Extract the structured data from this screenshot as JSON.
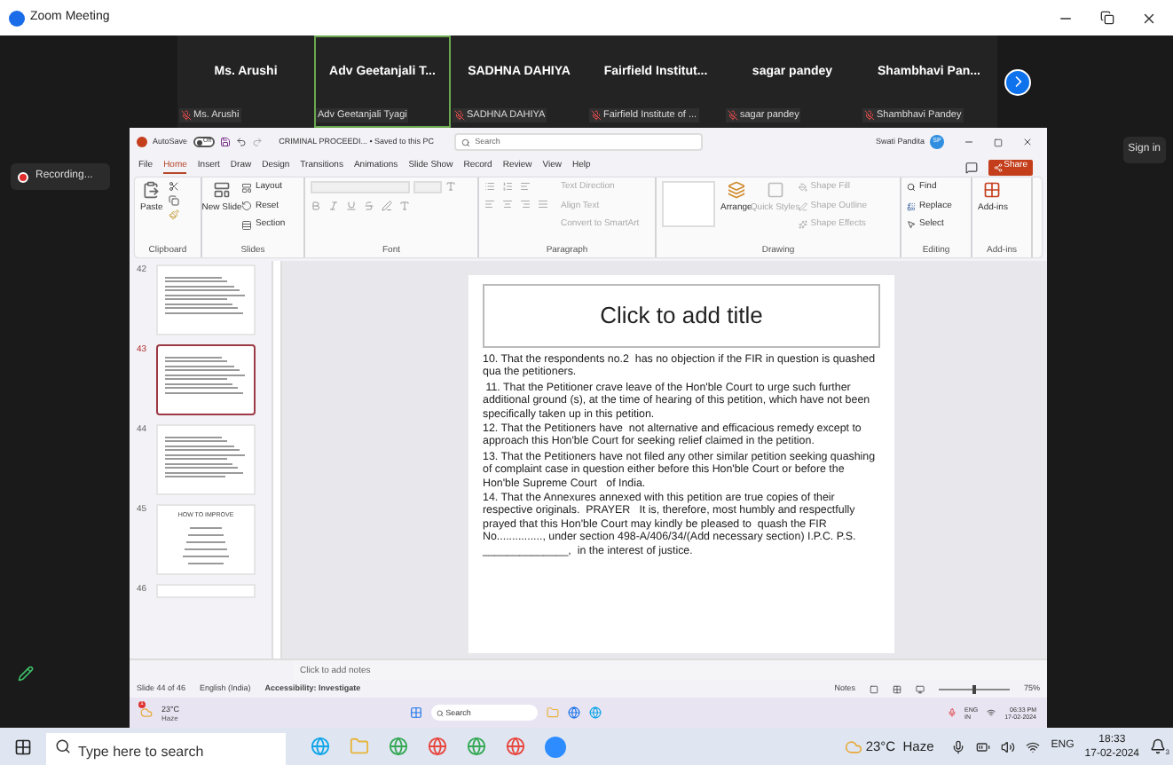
{
  "window": {
    "title": "Zoom Meeting"
  },
  "participants": [
    {
      "name": "Ms. Arushi",
      "label": "Ms. Arushi",
      "speaking": false
    },
    {
      "name": "Adv Geetanjali T...",
      "label": "Adv Geetanjali Tyagi",
      "speaking": true
    },
    {
      "name": "SADHNA DAHIYA",
      "label": "SADHNA DAHIYA",
      "speaking": false
    },
    {
      "name": "Fairfield Institut...",
      "label": "Fairfield Institute of ...",
      "speaking": false
    },
    {
      "name": "sagar pandey",
      "label": "sagar pandey",
      "speaking": false
    },
    {
      "name": "Shambhavi Pan...",
      "label": "Shambhavi Pandey",
      "speaking": false
    }
  ],
  "recording": "Recording...",
  "sign_in": "Sign in",
  "ppt": {
    "autosave": "AutoSave",
    "autosave_state": "Off",
    "autosave_on": false,
    "file_title": "CRIMINAL PROCEEDI... • Saved to this PC",
    "search": {
      "placeholder": "Search"
    },
    "user": "Swati Pandita",
    "avatar": "SP",
    "share": "Share",
    "tabs": [
      {
        "label": "File",
        "selected": false
      },
      {
        "label": "Home",
        "selected": true
      },
      {
        "label": "Insert",
        "selected": false
      },
      {
        "label": "Draw",
        "selected": false
      },
      {
        "label": "Design",
        "selected": false
      },
      {
        "label": "Transitions",
        "selected": false
      },
      {
        "label": "Animations",
        "selected": false
      },
      {
        "label": "Slide Show",
        "selected": false
      },
      {
        "label": "Record",
        "selected": false
      },
      {
        "label": "Review",
        "selected": false
      },
      {
        "label": "View",
        "selected": false
      },
      {
        "label": "Help",
        "selected": false
      }
    ],
    "ribbon": {
      "paste": "Paste",
      "clipboard": "Clipboard",
      "new_slide": "New Slide",
      "layout": "Layout",
      "reset": "Reset",
      "section": "Section",
      "slides": "Slides",
      "font": "Font",
      "text_direction": "Text Direction",
      "align_text": "Align Text",
      "smartart": "Convert to SmartArt",
      "paragraph": "Paragraph",
      "arrange": "Arrange",
      "quick_styles": "Quick Styles",
      "shape_fill": "Shape Fill",
      "shape_outline": "Shape Outline",
      "shape_effects": "Shape Effects",
      "drawing": "Drawing",
      "find": "Find",
      "replace": "Replace",
      "select": "Select",
      "editing": "Editing",
      "addins_button": "Add-ins",
      "addins": "Add-ins"
    },
    "thumbnails": [
      {
        "number": "42",
        "selected": false,
        "kind": "text"
      },
      {
        "number": "43",
        "selected": true,
        "kind": "text"
      },
      {
        "number": "44",
        "selected": false,
        "kind": "text"
      },
      {
        "number": "45",
        "selected": false,
        "kind": "list",
        "title": "HOW TO IMPROVE"
      },
      {
        "number": "46",
        "selected": false,
        "kind": "blank"
      }
    ],
    "slide": {
      "title": "Click to add title",
      "paragraphs": [
        "10. That the respondents no.2  has no objection if the FIR in question is quashed qua the petitioners.",
        " 11. That the Petitioner crave leave of the Hon'ble Court to urge such further additional ground (s), at the time of hearing of this petition, which have not been specifically taken up in this petition.",
        "12. That the Petitioners have  not alternative and efficacious remedy except to approach this Hon'ble Court for seeking relief claimed in the petition.",
        "13. That the Petitioners have not filed any other similar petition seeking quashing of complaint case in question either before this Hon'ble Court or before the Hon'ble Supreme Court   of India.",
        "14. That the Annexures annexed with this petition are true copies of their respective originals.  PRAYER   It is, therefore, most humbly and respectfully prayed that this Hon'ble Court may kindly be pleased to  quash the FIR No..............., under section 498-A/406/34/(Add necessary section) I.P.C. P.S. ______________,  in the interest of justice."
      ]
    },
    "notes": {
      "placeholder": "Click to add notes"
    },
    "status": {
      "slide": "Slide 44 of 46",
      "language": "English (India)",
      "accessibility": "Accessibility: Investigate",
      "notes": "Notes",
      "zoom": "75%",
      "zoom_slider": {
        "level": 0.5
      }
    }
  },
  "remote_taskbar": {
    "temperature": "23°C",
    "condition": "Haze",
    "alert": "1",
    "search": {
      "placeholder": "Search"
    },
    "lang": "ENG",
    "region": "IN",
    "time": "06:33 PM",
    "date": "17-02-2024"
  },
  "taskbar": {
    "search": {
      "placeholder": "Type here to search"
    },
    "weather": "23°C  Haze",
    "lang": "ENG",
    "time": "18:33",
    "date": "17-02-2024",
    "notifications": "3"
  }
}
